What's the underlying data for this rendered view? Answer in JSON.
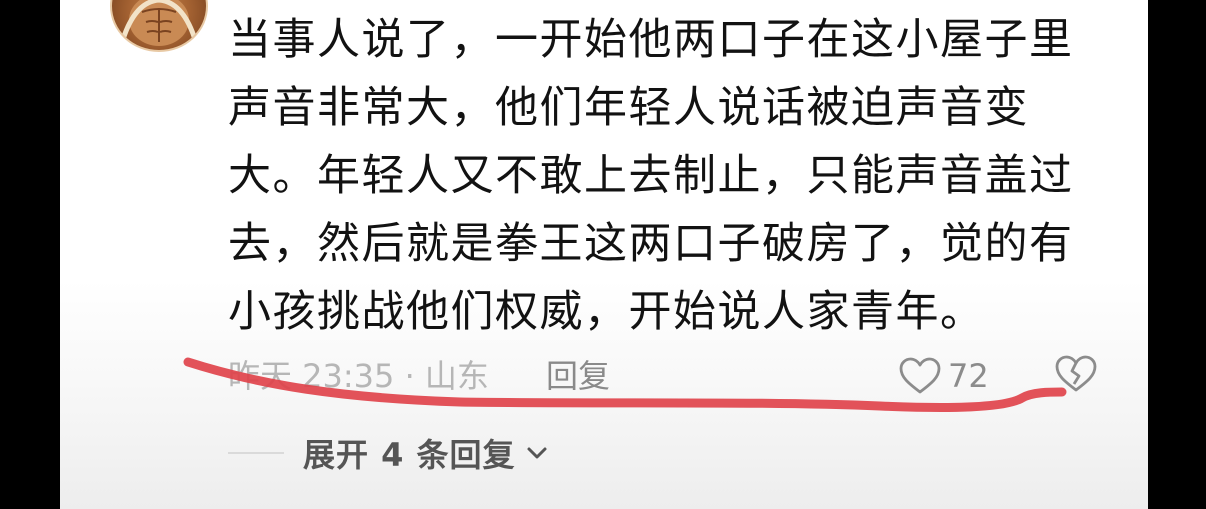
{
  "comment": {
    "text": "当事人说了，一开始他两口子在这小屋子里声音非常大，他们年轻人说话被迫声音变大。年轻人又不敢上去制止，只能声音盖过去，然后就是拳王这两口子破房了，觉的有小孩挑战他们权威，开始说人家青年。",
    "time_location": "昨天 23:35 · 山东",
    "reply_label": "回复",
    "like_count": "72",
    "like_icon": "heart-outline-icon",
    "dislike_icon": "broken-heart-icon"
  },
  "replies": {
    "expand_label": "展开 4 条回复",
    "expand_icon": "chevron-down-icon"
  },
  "colors": {
    "annotation_stroke": "#e0434b",
    "text_primary": "#121212",
    "text_meta": "#b6b6b6"
  }
}
